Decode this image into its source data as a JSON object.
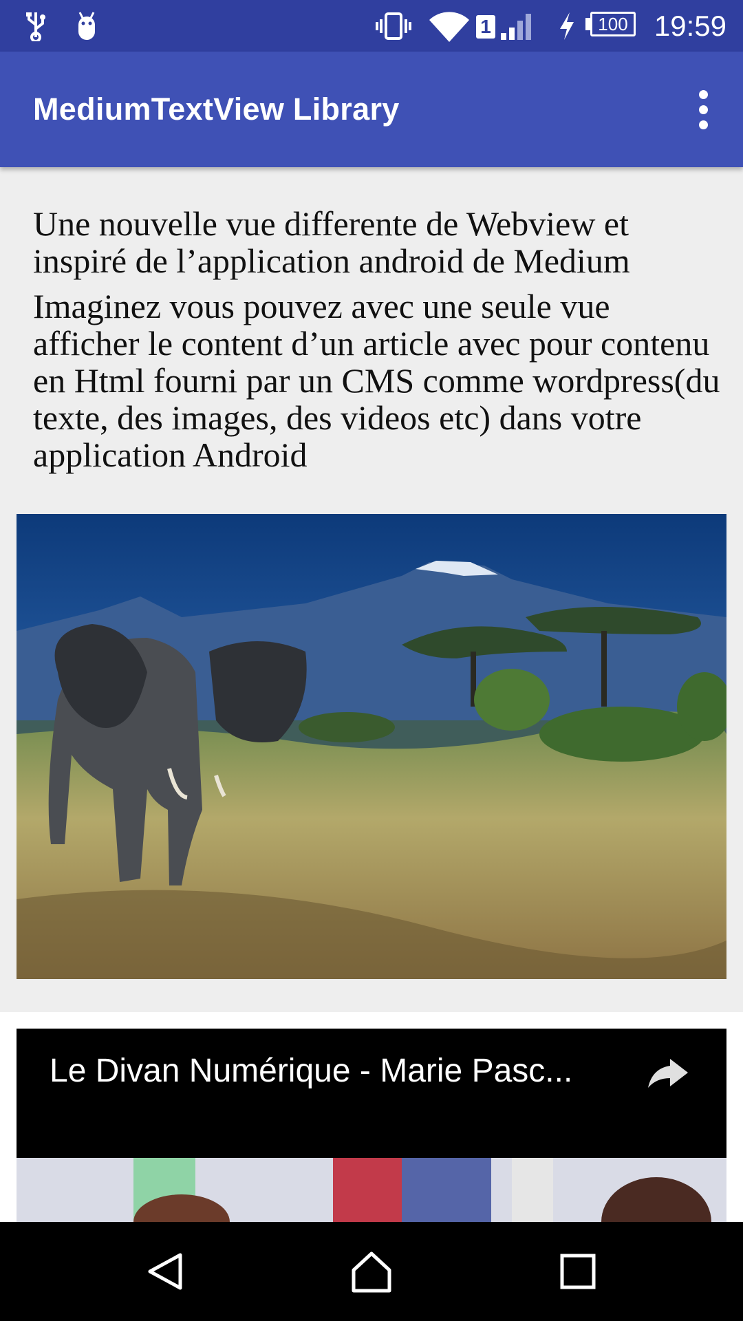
{
  "status_bar": {
    "time": "19:59",
    "battery_level": "100",
    "sim_slot": "1",
    "icons": [
      "usb-icon",
      "android-debug-icon",
      "vibrate-icon",
      "wifi-icon",
      "signal-icon",
      "charging-icon",
      "battery-icon"
    ]
  },
  "app_bar": {
    "title": "MediumTextView Library",
    "menu_icon": "more-vert-icon",
    "color": "#3f51b5",
    "status_color": "#303f9f"
  },
  "article": {
    "paragraphs": [
      "Une nouvelle vue differente de Webview et inspiré de l’application android de Medium",
      "Imaginez vous pouvez avec une seule vue afficher le content d’un article avec pour contenu en Html fourni par un CMS comme wordpress(du texte, des images, des videos etc) dans votre application Android"
    ]
  },
  "video": {
    "title": "Le Divan Numérique - Marie Pasc...",
    "share_icon": "share-icon"
  },
  "nav_bar": {
    "icons": [
      "back-icon",
      "home-icon",
      "recents-icon"
    ]
  }
}
